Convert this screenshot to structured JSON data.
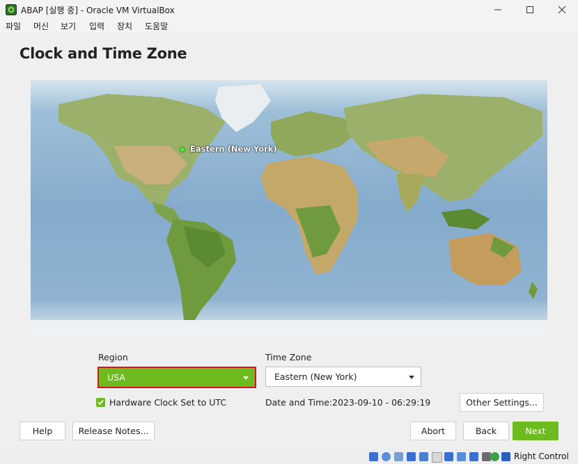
{
  "window": {
    "title": "ABAP [실행 중] - Oracle VM VirtualBox",
    "menu": [
      "파일",
      "머신",
      "보기",
      "입력",
      "장치",
      "도움말"
    ]
  },
  "page": {
    "title": "Clock and Time Zone"
  },
  "map": {
    "selected_label": "Eastern (New York)"
  },
  "form": {
    "region_label": "Region",
    "region_value": "USA",
    "timezone_label": "Time Zone",
    "timezone_value": "Eastern (New York)",
    "hwclock_label": "Hardware Clock Set to UTC",
    "hwclock_checked": true,
    "datetime_label": "Date and Time:",
    "datetime_value": "2023-09-10 - 06:29:19",
    "other_settings_label": "Other Settings..."
  },
  "buttons": {
    "help": "Help",
    "release_notes": "Release Notes...",
    "abort": "Abort",
    "back": "Back",
    "next": "Next"
  },
  "statusbar": {
    "host_key": "Right Control"
  },
  "colors": {
    "accent_green": "#6dbb1f",
    "highlight_red": "#d9131a"
  }
}
